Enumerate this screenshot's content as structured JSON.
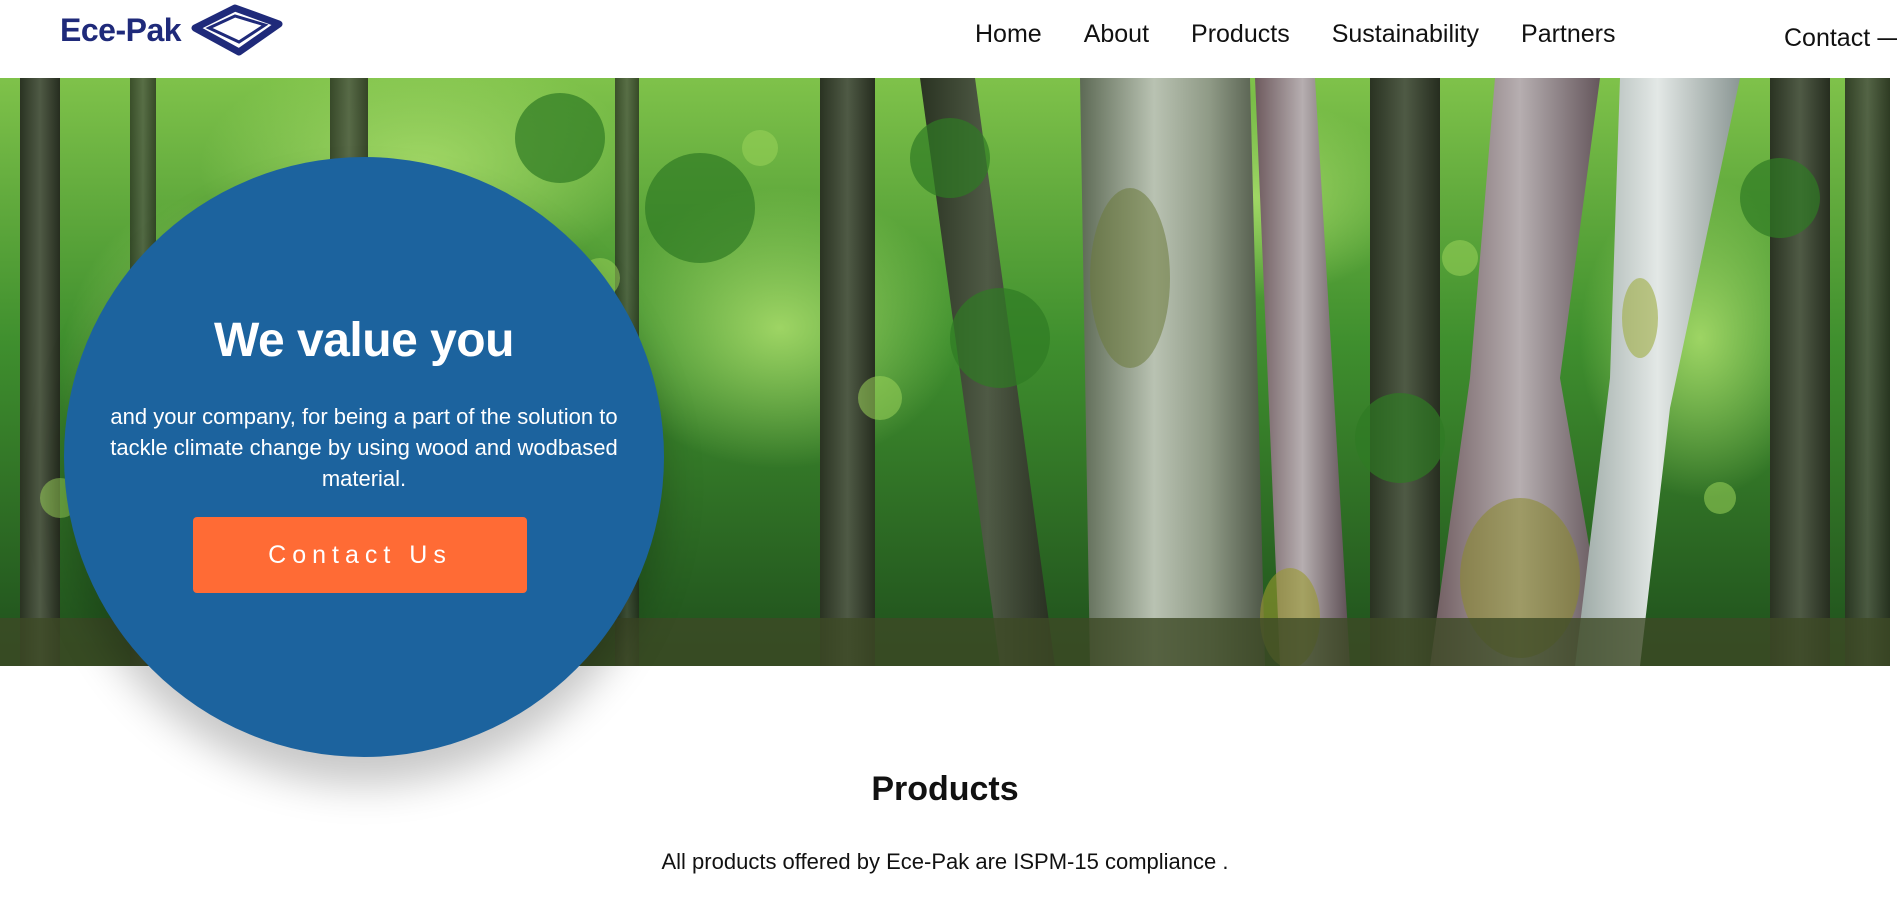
{
  "header": {
    "logo_text": "Ece-Pak",
    "brand_color": "#1f2a7a",
    "nav": [
      {
        "label": "Home"
      },
      {
        "label": "About"
      },
      {
        "label": "Products"
      },
      {
        "label": "Sustainability"
      },
      {
        "label": "Partners"
      }
    ],
    "contact_label": "Contact",
    "contact_icon": "arrow-right-icon"
  },
  "hero": {
    "background": "forest-image",
    "card_color": "#1c639e",
    "title": "We value you",
    "text": "and your company, for being a part of the solution to tackle climate change by using wood and wodbased material.",
    "button_label": "Contact Us",
    "button_color": "#ff6b35"
  },
  "products": {
    "title": "Products",
    "subtitle": "All products offered by Ece-Pak are ISPM-15 compliance ."
  }
}
